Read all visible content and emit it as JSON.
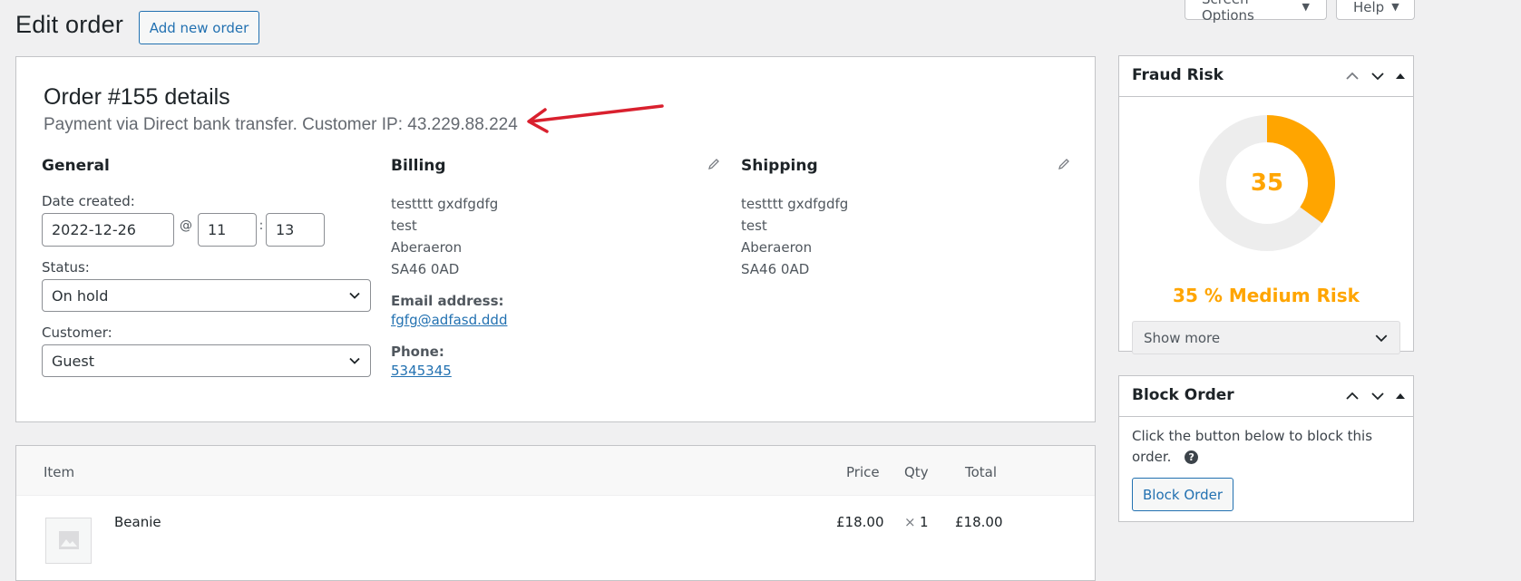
{
  "header": {
    "title": "Edit order",
    "add_new_label": "Add new order",
    "screen_options_label": "Screen Options",
    "help_label": "Help"
  },
  "order": {
    "title": "Order #155 details",
    "meta": "Payment via Direct bank transfer. Customer IP: 43.229.88.224"
  },
  "general": {
    "heading": "General",
    "date_label": "Date created:",
    "date_value": "2022-12-26",
    "at_sep": "@",
    "hour_value": "11",
    "time_sep": ":",
    "minute_value": "13",
    "status_label": "Status:",
    "status_value": "On hold",
    "customer_label": "Customer:",
    "customer_value": "Guest"
  },
  "billing": {
    "heading": "Billing",
    "lines": [
      "testttt gxdfgdfg",
      "test",
      "Aberaeron",
      "SA46 0AD"
    ],
    "email_label": "Email address:",
    "email": "fgfg@adfasd.ddd",
    "phone_label": "Phone:",
    "phone": "5345345"
  },
  "shipping": {
    "heading": "Shipping",
    "lines": [
      "testttt gxdfgdfg",
      "test",
      "Aberaeron",
      "SA46 0AD"
    ]
  },
  "items": {
    "headers": {
      "item": "Item",
      "price": "Price",
      "qty": "Qty",
      "total": "Total"
    },
    "rows": [
      {
        "name": "Beanie",
        "price": "£18.00",
        "qty_sep": "×",
        "qty": "1",
        "total": "£18.00"
      }
    ]
  },
  "fraud": {
    "title": "Fraud Risk",
    "score": "35",
    "score_fraction": 0.35,
    "label": "35 % Medium Risk",
    "show_more_label": "Show more",
    "colors": {
      "risk": "#ffa500",
      "track": "#ededed"
    }
  },
  "block_order": {
    "title": "Block Order",
    "description": "Click the button below to block this order.",
    "help_icon": "?",
    "button_label": "Block Order"
  },
  "annotation": {
    "arrow_color": "#d9202e"
  }
}
